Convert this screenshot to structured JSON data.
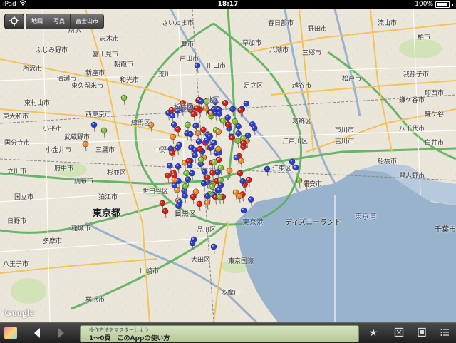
{
  "status": {
    "device": "iPad",
    "time": "18:17",
    "battery": "100%"
  },
  "map_controls": {
    "locate_icon": "crosshair-icon",
    "tabs": [
      "地図",
      "写真",
      "富士山市"
    ]
  },
  "places": {
    "saitama": "さいたま市",
    "shiki": "志木市",
    "tokorozawa": "所沢市",
    "niiza": "新座市",
    "asaka": "朝霞市",
    "wako": "和光市",
    "kiyose": "清瀬市",
    "higashikurume": "東久留米市",
    "higashimurayama": "東村山市",
    "nishitokyo": "西東京市",
    "higashiyamato": "東大和市",
    "kodaira": "小平市",
    "kokubunji": "国分寺市",
    "koganei": "小金井市",
    "musashino": "武蔵野市",
    "mitaka": "三鷹市",
    "fuchu": "府中市",
    "chofu": "調布市",
    "komae": "狛江市",
    "tama": "多摩市",
    "inagi": "稲城市",
    "tokyo": "東京都",
    "nerima": "練馬区",
    "itabashi": "板橋区",
    "kita": "北区",
    "adachi": "足立区",
    "arakawa": "荒川",
    "katsushika": "葛飾区",
    "edogawa": "江戸川区",
    "koto": "江東区",
    "suginami": "杉並区",
    "nakano": "中野",
    "setagaya": "世田谷区",
    "meguro": "目黒区",
    "shinagawa": "品川区",
    "ota": "大田区",
    "kawaguchi": "川口市",
    "toda": "戸田市",
    "warabi": "蕨市",
    "soka": "草加市",
    "yashio": "八潮市",
    "misato": "三郷市",
    "matsudo": "松戸市",
    "ichikawa": "市川市",
    "funabashi": "船橋市",
    "urayasu": "浦安市",
    "narashino": "習志野市",
    "chiba": "千葉市",
    "kamagaya": "鎌ケ谷市",
    "yachiyo": "八千代市",
    "kashiwa": "柏市",
    "nagareyama": "流山市",
    "abiko": "我孫子市",
    "noda": "野田市",
    "kasukabe": "春日部市",
    "koshigaya": "越谷市",
    "yoshikawa": "吉川市",
    "kawasaki": "川崎市",
    "yokohama": "横浜市",
    "tokyo_bay": "東京湾",
    "tokyo_port": "東京港",
    "disneyland": "ディズニーランド",
    "haneda": "東京国際",
    "tamagawa": "多摩川",
    "fujimino": "ふじみ野市",
    "fujimi": "富士見市",
    "tachikawa": "立川市",
    "kunitachi": "国立市",
    "hino": "日野市",
    "hachioji": "八王子市",
    "kamagaya2": "鎌ケ谷",
    "shiroi": "白井市",
    "inzai": "印西市",
    "tokorozawa2": "所沢"
  },
  "attribution": "Google",
  "toolbar": {
    "thumbnail_icon": "app-thumbnail-icon",
    "back_icon": "back-arrow-icon",
    "forward_icon": "forward-arrow-icon",
    "guide_sub": "操作方法をマスターしよう",
    "guide_title": "1〜0頁　このAppの使い方",
    "star_icon": "star-icon",
    "map_icon": "map-icon",
    "frame_icon": "frame-icon",
    "list_icon": "list-icon"
  },
  "pin_colors": {
    "blue": "#2b3fd6",
    "red": "#e01b12",
    "green": "#7cc23c",
    "orange": "#f08a2a"
  }
}
